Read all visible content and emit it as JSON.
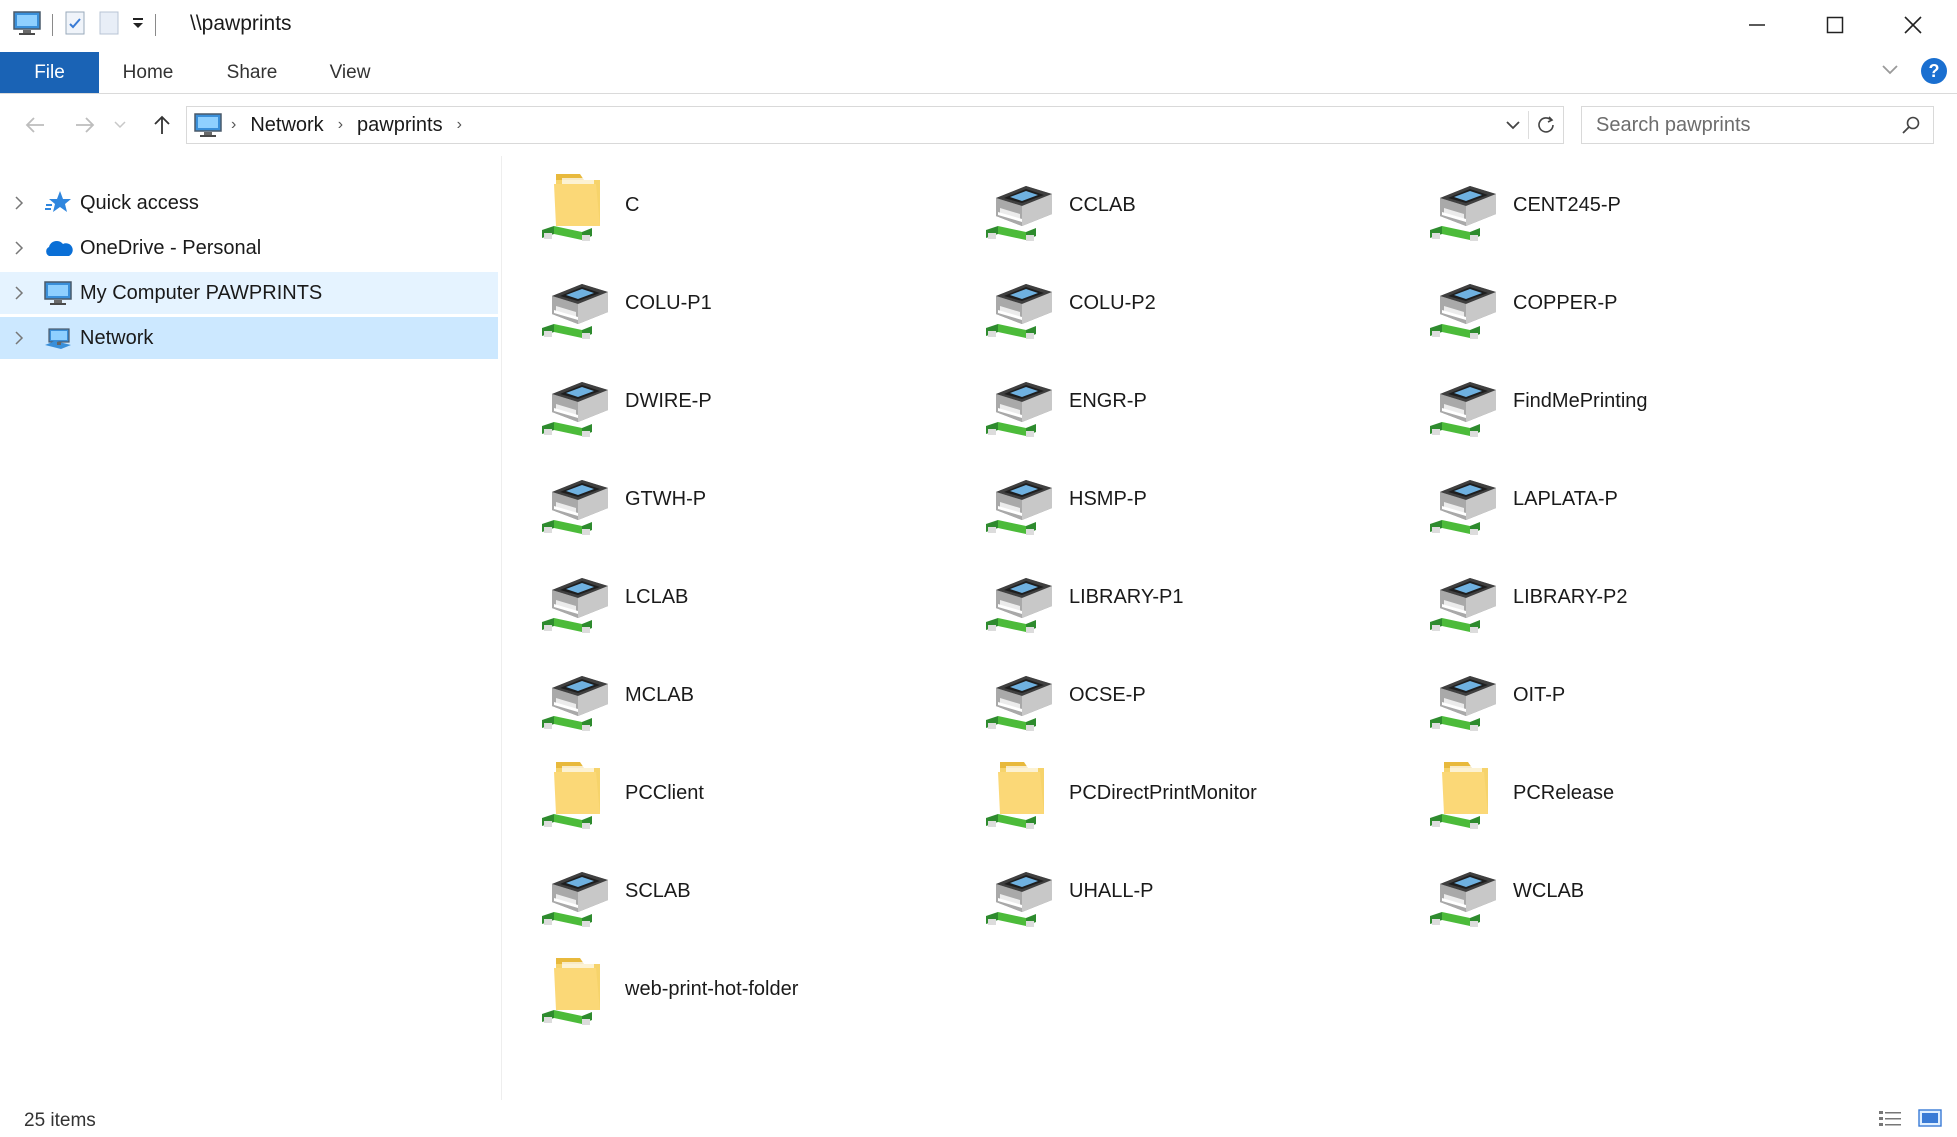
{
  "window": {
    "title": "\\\\pawprints",
    "colors": {
      "accent": "#1a63b5",
      "selected": "#cce8ff",
      "hover": "#e5f3ff"
    }
  },
  "ribbon": {
    "tabs": [
      "File",
      "Home",
      "Share",
      "View"
    ]
  },
  "address": {
    "crumbs": [
      "Network",
      "pawprints"
    ]
  },
  "search": {
    "placeholder": "Search pawprints"
  },
  "sidebar": {
    "items": [
      {
        "label": "Quick access",
        "icon": "quick-access-star-icon"
      },
      {
        "label": "OneDrive - Personal",
        "icon": "onedrive-cloud-icon"
      },
      {
        "label": "My Computer PAWPRINTS",
        "icon": "computer-icon"
      },
      {
        "label": "Network",
        "icon": "network-icon"
      }
    ]
  },
  "items": [
    {
      "name": "C",
      "type": "shared-folder"
    },
    {
      "name": "CCLAB",
      "type": "shared-printer"
    },
    {
      "name": "CENT245-P",
      "type": "shared-printer"
    },
    {
      "name": "COLU-P1",
      "type": "shared-printer"
    },
    {
      "name": "COLU-P2",
      "type": "shared-printer"
    },
    {
      "name": "COPPER-P",
      "type": "shared-printer"
    },
    {
      "name": "DWIRE-P",
      "type": "shared-printer"
    },
    {
      "name": "ENGR-P",
      "type": "shared-printer"
    },
    {
      "name": "FindMePrinting",
      "type": "shared-printer"
    },
    {
      "name": "GTWH-P",
      "type": "shared-printer"
    },
    {
      "name": "HSMP-P",
      "type": "shared-printer"
    },
    {
      "name": "LAPLATA-P",
      "type": "shared-printer"
    },
    {
      "name": "LCLAB",
      "type": "shared-printer"
    },
    {
      "name": "LIBRARY-P1",
      "type": "shared-printer"
    },
    {
      "name": "LIBRARY-P2",
      "type": "shared-printer"
    },
    {
      "name": "MCLAB",
      "type": "shared-printer"
    },
    {
      "name": "OCSE-P",
      "type": "shared-printer"
    },
    {
      "name": "OIT-P",
      "type": "shared-printer"
    },
    {
      "name": "PCClient",
      "type": "shared-folder"
    },
    {
      "name": "PCDirectPrintMonitor",
      "type": "shared-folder"
    },
    {
      "name": "PCRelease",
      "type": "shared-folder"
    },
    {
      "name": "SCLAB",
      "type": "shared-printer"
    },
    {
      "name": "UHALL-P",
      "type": "shared-printer"
    },
    {
      "name": "WCLAB",
      "type": "shared-printer"
    },
    {
      "name": "web-print-hot-folder",
      "type": "shared-folder"
    }
  ],
  "status": {
    "count_text": "25 items"
  }
}
